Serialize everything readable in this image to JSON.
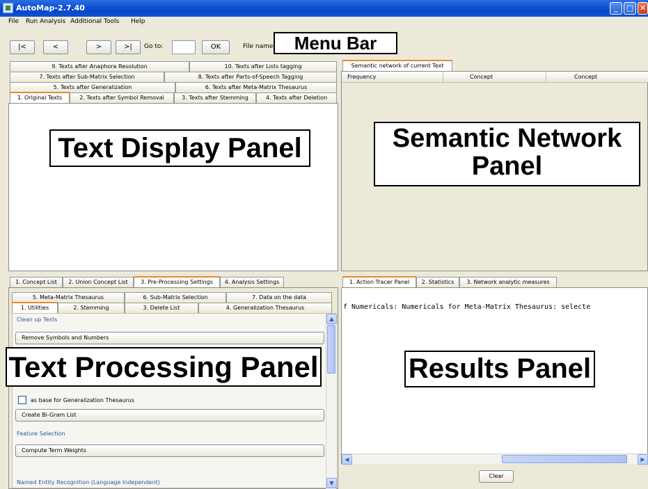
{
  "window": {
    "title": "AutoMap-2.7.40",
    "controls": {
      "minimize": "_",
      "maximize": "□",
      "close": "✕"
    }
  },
  "menubar": {
    "items": [
      "File",
      "Run Analysis",
      "Additional Tools",
      "Help"
    ]
  },
  "toolbar": {
    "first_label": "|<",
    "prev_label": "<",
    "next_label": ">",
    "last_label": ">|",
    "goto_label": "Go to:",
    "goto_value": "",
    "ok_label": "OK",
    "filename_label": "File name:"
  },
  "annotations": {
    "menu_bar": "Menu Bar",
    "text_display": "Text Display Panel",
    "semantic_network_line1": "Semantic Network",
    "semantic_network_line2": "Panel",
    "text_processing": "Text Processing Panel",
    "results": "Results Panel"
  },
  "text_display_panel": {
    "tabs_row1": [
      "9. Texts after Anaphora Resolution",
      "10. Texts after Lists tagging"
    ],
    "tabs_row2": [
      "7. Texts after Sub-Matrix Selection",
      "8. Texts after Parts-of-Speech Tagging"
    ],
    "tabs_row3": [
      "5. Texts after Generalization",
      "6. Texts after Meta-Matrix Thesaurus"
    ],
    "tabs_row4": [
      "1. Original Texts",
      "2. Texts after Symbol Removal",
      "3. Texts after Stemming",
      "4. Texts after Deletion"
    ],
    "active_tab": "1. Original Texts"
  },
  "semantic_network_panel": {
    "tab": "Semantic network of current Text",
    "columns": [
      "Frequency",
      "Concept",
      "Concept"
    ]
  },
  "processing_panel": {
    "top_tabs": [
      "1. Concept List",
      "2. Union Concept List",
      "3. Pre-Processing Settings",
      "4. Analysis Settings"
    ],
    "active_top_tab": "3. Pre-Processing Settings",
    "sub_tabs_row1": [
      "5. Meta-Matrix Thesaurus",
      "6. Sub-Matrix Selection",
      "7. Data on the data"
    ],
    "sub_tabs_row2": [
      "1. Utilities",
      "2. Stemming",
      "3. Delete List",
      "4. Generalization Thesaurus"
    ],
    "active_sub_tab": "1. Utilities",
    "clean_up_label": "Clean up Texts",
    "remove_symbols_button": "Remove Symbols and Numbers",
    "checkbox_label": "as base for Generalization Thesaurus",
    "checkbox_checked": false,
    "bigram_button": "Create Bi-Gram List",
    "feature_selection_label": "Feature Selection",
    "term_weights_button": "Compute Term Weights",
    "ner_label": "Named Entity Recognition (Language Independent)"
  },
  "results_panel": {
    "tabs": [
      "1. Action Tracer Panel",
      "2. Statistics",
      "3. Network analytic measures"
    ],
    "active_tab": "1. Action Tracer Panel",
    "output_text": "f Numericals: Numericals for Meta-Matrix Thesaurus: selecte",
    "clear_button": "Clear"
  }
}
